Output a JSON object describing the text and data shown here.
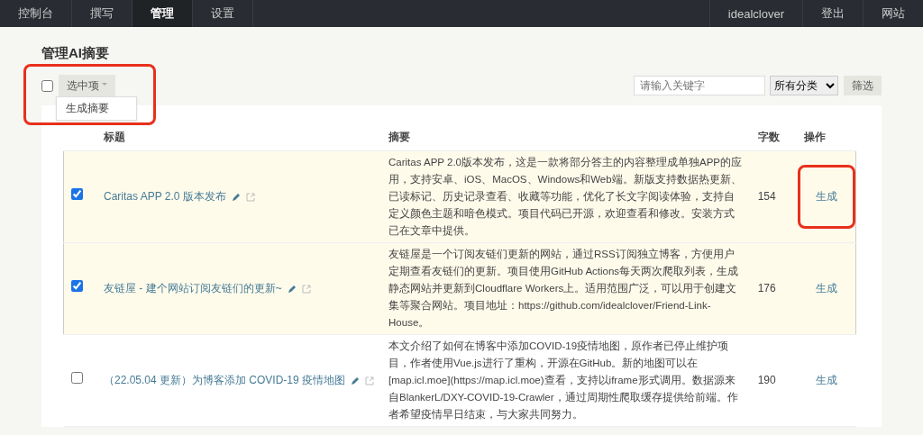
{
  "nav": {
    "left": [
      {
        "label": "控制台",
        "selected": false
      },
      {
        "label": "撰写",
        "selected": false
      },
      {
        "label": "管理",
        "selected": true
      },
      {
        "label": "设置",
        "selected": false
      }
    ],
    "right": [
      "idealclover",
      "登出",
      "网站"
    ]
  },
  "page_title": "管理AI摘要",
  "toolbar": {
    "select_all": {
      "checked": false
    },
    "bulk_button": {
      "label": "选中项",
      "highlighted": true
    },
    "bulk_menu": [
      "生成摘要"
    ],
    "search": {
      "placeholder": "请输入关键字"
    },
    "category": {
      "value": "所有分类"
    },
    "filter_button": "筛选"
  },
  "table": {
    "columns": [
      "标题",
      "摘要",
      "字数",
      "操作"
    ],
    "rows": [
      {
        "selected": true,
        "title": "Caritas APP 2.0 版本发布",
        "summary": "Caritas APP 2.0版本发布，这是一款将部分答主的内容整理成单独APP的应用，支持安卓、iOS、MacOS、Windows和Web端。新版支持数据热更新、已读标记、历史记录查看、收藏等功能，优化了长文字阅读体验，支持自定义颜色主题和暗色模式。项目代码已开源，欢迎查看和修改。安装方式已在文章中提供。",
        "count": "154",
        "action": "生成",
        "highlighted": true
      },
      {
        "selected": true,
        "title": "友链屋 - 建个网站订阅友链们的更新~",
        "summary": "友链屋是一个订阅友链们更新的网站，通过RSS订阅独立博客，方便用户定期查看友链们的更新。项目使用GitHub Actions每天两次爬取列表，生成静态网站并更新到Cloudflare Workers上。适用范围广泛，可以用于创建文集等聚合网站。项目地址：https://github.com/idealclover/Friend-Link-House。",
        "count": "176",
        "action": "生成",
        "highlighted": false
      },
      {
        "selected": false,
        "title": "（22.05.04 更新）为博客添加 COVID-19 疫情地图",
        "summary": "本文介绍了如何在博客中添加COVID-19疫情地图，原作者已停止维护项目，作者使用Vue.js进行了重构，开源在GitHub。新的地图可以在[map.icl.moe](https://map.icl.moe)查看，支持以iframe形式调用。数据源来自BlankerL/DXY-COVID-19-Crawler，通过周期性爬取缓存提供给前端。作者希望疫情早日结束，与大家共同努力。",
        "count": "190",
        "action": "生成",
        "highlighted": false
      }
    ]
  }
}
